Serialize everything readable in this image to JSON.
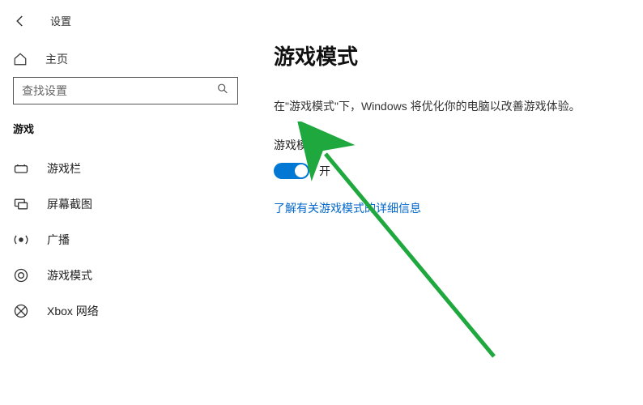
{
  "topbar": {
    "title": "设置"
  },
  "sidebar": {
    "home_label": "主页",
    "search_placeholder": "查找设置",
    "category": "游戏",
    "items": [
      {
        "label": "游戏栏"
      },
      {
        "label": "屏幕截图"
      },
      {
        "label": "广播"
      },
      {
        "label": "游戏模式"
      },
      {
        "label": "Xbox 网络"
      }
    ]
  },
  "main": {
    "title": "游戏模式",
    "description": "在\"游戏模式\"下，Windows 将优化你的电脑以改善游戏体验。",
    "toggle_label": "游戏模式",
    "toggle_state": "开",
    "link_text": "了解有关游戏模式的详细信息"
  },
  "colors": {
    "accent": "#0078d4",
    "link": "#0066cc",
    "arrow": "#1ea83e"
  }
}
